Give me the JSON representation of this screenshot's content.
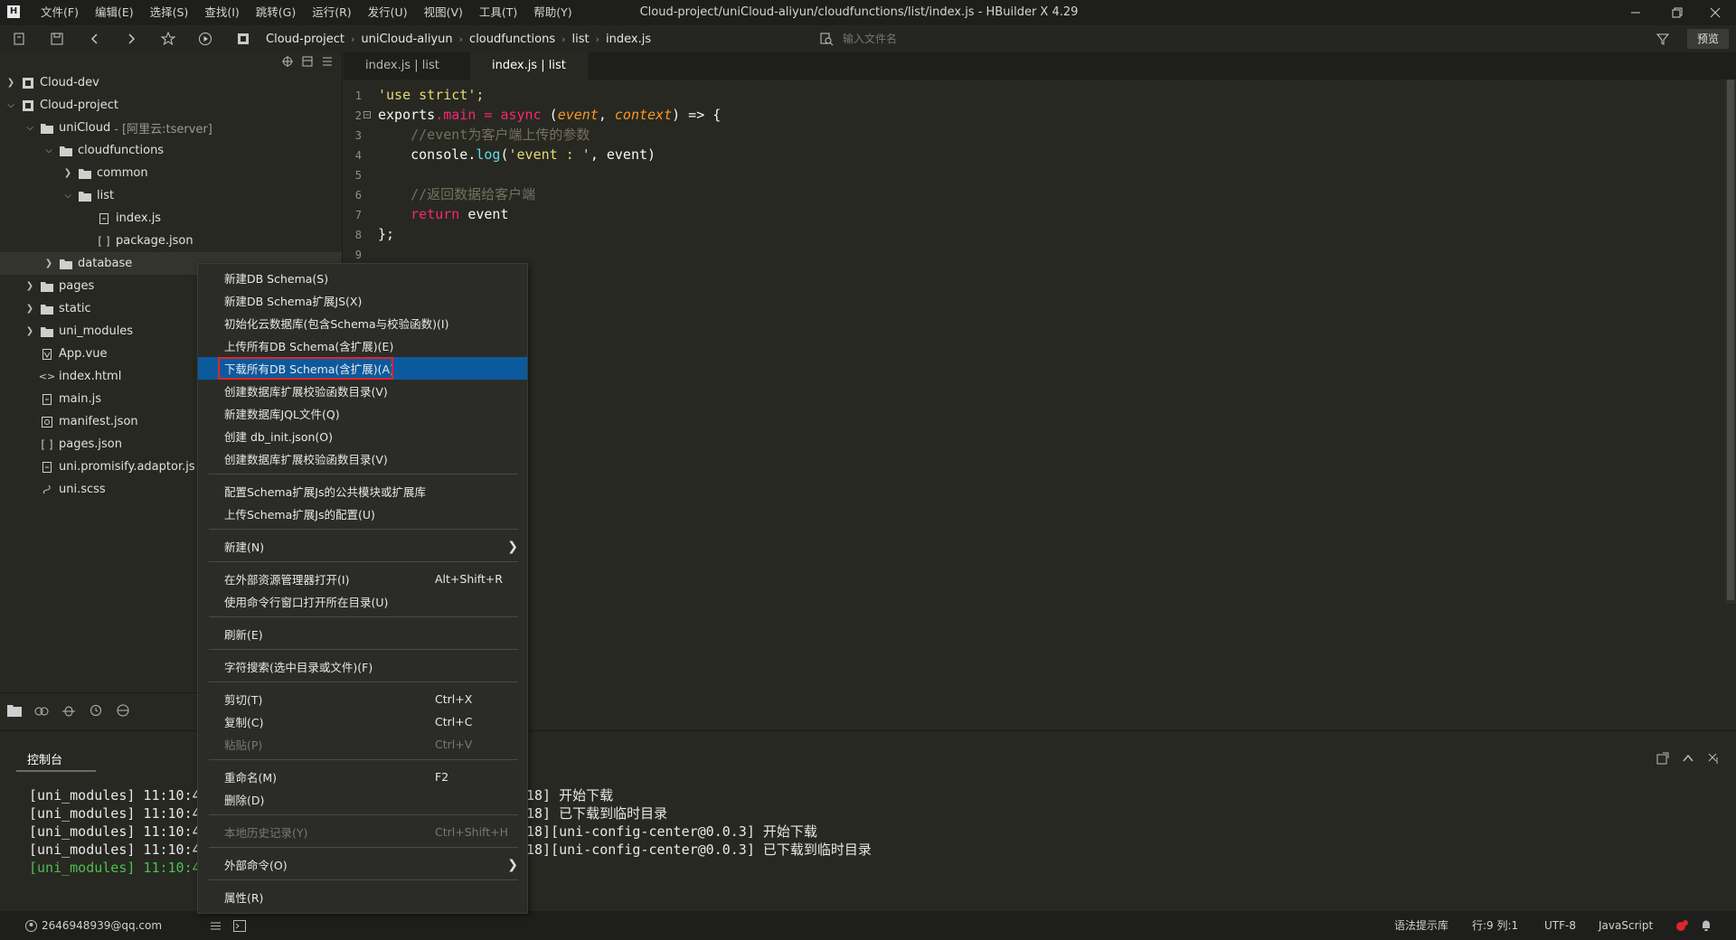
{
  "app": {
    "logo": "H",
    "title": "Cloud-project/uniCloud-aliyun/cloudfunctions/list/index.js - HBuilder X 4.29"
  },
  "menu": [
    "文件(F)",
    "编辑(E)",
    "选择(S)",
    "查找(I)",
    "跳转(G)",
    "运行(R)",
    "发行(U)",
    "视图(V)",
    "工具(T)",
    "帮助(Y)"
  ],
  "breadcrumb": [
    "Cloud-project",
    "uniCloud-aliyun",
    "cloudfunctions",
    "list",
    "index.js"
  ],
  "file_search": {
    "placeholder": "输入文件名"
  },
  "preview_label": "预览",
  "tree": [
    {
      "label": "Cloud-dev",
      "sub": ""
    },
    {
      "label": "Cloud-project",
      "sub": ""
    },
    {
      "label": "uniCloud",
      "sub": "- [阿里云:tserver]"
    },
    {
      "label": "cloudfunctions",
      "sub": ""
    },
    {
      "label": "common",
      "sub": ""
    },
    {
      "label": "list",
      "sub": ""
    },
    {
      "label": "index.js",
      "sub": ""
    },
    {
      "label": "package.json",
      "sub": ""
    },
    {
      "label": "database",
      "sub": ""
    },
    {
      "label": "pages",
      "sub": ""
    },
    {
      "label": "static",
      "sub": ""
    },
    {
      "label": "uni_modules",
      "sub": ""
    },
    {
      "label": "App.vue",
      "sub": ""
    },
    {
      "label": "index.html",
      "sub": ""
    },
    {
      "label": "main.js",
      "sub": ""
    },
    {
      "label": "manifest.json",
      "sub": ""
    },
    {
      "label": "pages.json",
      "sub": ""
    },
    {
      "label": "uni.promisify.adaptor.js",
      "sub": ""
    },
    {
      "label": "uni.scss",
      "sub": ""
    }
  ],
  "tabs": [
    {
      "label": "index.js | list",
      "active": false
    },
    {
      "label": "index.js | list",
      "active": true
    }
  ],
  "code": {
    "line_numbers": [
      "1",
      "2",
      "3",
      "4",
      "5",
      "6",
      "7",
      "8",
      "9"
    ],
    "l1": "'use strict';",
    "l2_a": "exports",
    "l2_b": ".main = ",
    "l2_c": "async",
    "l2_d": " (",
    "l2_e": "event",
    "l2_f": ", ",
    "l2_g": "context",
    "l2_h": ") => {",
    "l3": "//event为客户端上传的参数",
    "l4_a": "console",
    "l4_b": ".",
    "l4_c": "log",
    "l4_d": "(",
    "l4_e": "'event : '",
    "l4_f": ", event)",
    "l6": "//返回数据给客户端",
    "l7_a": "return",
    "l7_b": " event",
    "l8": "};"
  },
  "console": {
    "tab_label": "控制台",
    "lines": [
      {
        "prefix": "[uni_modules] 11:10:4",
        "rest": "18] 开始下载"
      },
      {
        "prefix": "[uni_modules] 11:10:4",
        "rest": "18] 已下载到临时目录"
      },
      {
        "prefix": "[uni_modules] 11:10:4",
        "rest": "18][uni-config-center@0.0.3] 开始下载"
      },
      {
        "prefix": "[uni_modules] 11:10:4",
        "rest": "18][uni-config-center@0.0.3] 已下载到临时目录"
      },
      {
        "prefix": "[uni_modules] 11:10:4",
        "rest": ""
      }
    ]
  },
  "context_menu": {
    "items": [
      {
        "label": "新建DB Schema(S)",
        "shortcut": ""
      },
      {
        "label": "新建DB Schema扩展JS(X)",
        "shortcut": ""
      },
      {
        "label": "初始化云数据库(包含Schema与校验函数)(I)",
        "shortcut": ""
      },
      {
        "label": "上传所有DB Schema(含扩展)(E)",
        "shortcut": ""
      },
      {
        "label": "下载所有DB Schema(含扩展)(A)",
        "shortcut": ""
      },
      {
        "label": "创建数据库扩展校验函数目录(V)",
        "shortcut": ""
      },
      {
        "label": "新建数据库JQL文件(Q)",
        "shortcut": ""
      },
      {
        "label": "创建 db_init.json(O)",
        "shortcut": ""
      },
      {
        "label": "创建数据库扩展校验函数目录(V)",
        "shortcut": ""
      },
      {
        "label": "配置Schema扩展Js的公共模块或扩展库",
        "shortcut": ""
      },
      {
        "label": "上传Schema扩展Js的配置(U)",
        "shortcut": ""
      },
      {
        "label": "新建(N)",
        "shortcut": ""
      },
      {
        "label": "在外部资源管理器打开(I)",
        "shortcut": "Alt+Shift+R"
      },
      {
        "label": "使用命令行窗口打开所在目录(U)",
        "shortcut": ""
      },
      {
        "label": "刷新(E)",
        "shortcut": ""
      },
      {
        "label": "字符搜索(选中目录或文件)(F)",
        "shortcut": ""
      },
      {
        "label": "剪切(T)",
        "shortcut": "Ctrl+X"
      },
      {
        "label": "复制(C)",
        "shortcut": "Ctrl+C"
      },
      {
        "label": "粘贴(P)",
        "shortcut": "Ctrl+V"
      },
      {
        "label": "重命名(M)",
        "shortcut": "F2"
      },
      {
        "label": "删除(D)",
        "shortcut": ""
      },
      {
        "label": "本地历史记录(Y)",
        "shortcut": "Ctrl+Shift+H"
      },
      {
        "label": "外部命令(O)",
        "shortcut": ""
      },
      {
        "label": "属性(R)",
        "shortcut": ""
      }
    ]
  },
  "status": {
    "user": "2646948939@qq.com",
    "syntax": "语法提示库",
    "position": "行:9  列:1",
    "encoding": "UTF-8",
    "language": "JavaScript"
  },
  "colors": {
    "accent": "#0c5a9e",
    "highlight_border": "#e0242b",
    "background": "#272822"
  }
}
